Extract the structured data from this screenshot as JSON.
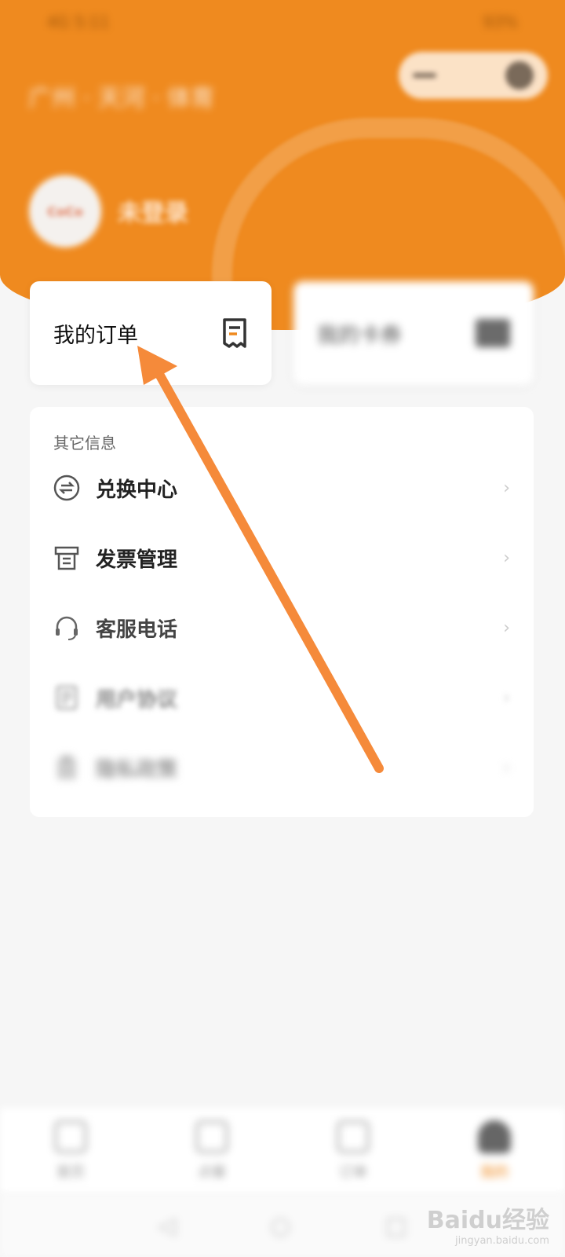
{
  "status_bar": {
    "left": "4G 5:11",
    "right": "93%"
  },
  "header": {
    "location": "广州 · 天河 · 体育",
    "login_status": "未登录",
    "avatar_logo": "CoCo"
  },
  "cards": {
    "orders": {
      "label": "我的订单",
      "icon": "receipt-icon"
    },
    "coupons": {
      "label": "我的卡券",
      "icon": "coupon-icon"
    }
  },
  "other_info": {
    "title": "其它信息",
    "items": [
      {
        "label": "兑换中心",
        "icon": "exchange-icon"
      },
      {
        "label": "发票管理",
        "icon": "invoice-icon"
      },
      {
        "label": "客服电话",
        "icon": "headset-icon"
      },
      {
        "label": "用户协议",
        "icon": "document-icon"
      },
      {
        "label": "隐私政策",
        "icon": "clipboard-icon"
      }
    ]
  },
  "tabbar": {
    "items": [
      {
        "label": "首页",
        "icon": "home-icon"
      },
      {
        "label": "点餐",
        "icon": "order-icon"
      },
      {
        "label": "订单",
        "icon": "list-icon"
      },
      {
        "label": "我的",
        "icon": "user-icon"
      }
    ]
  },
  "watermark": {
    "main": "Baidu经验",
    "sub": "jingyan.baidu.com"
  },
  "colors": {
    "brand": "#ef8a1f",
    "arrow": "#f58a3a"
  }
}
